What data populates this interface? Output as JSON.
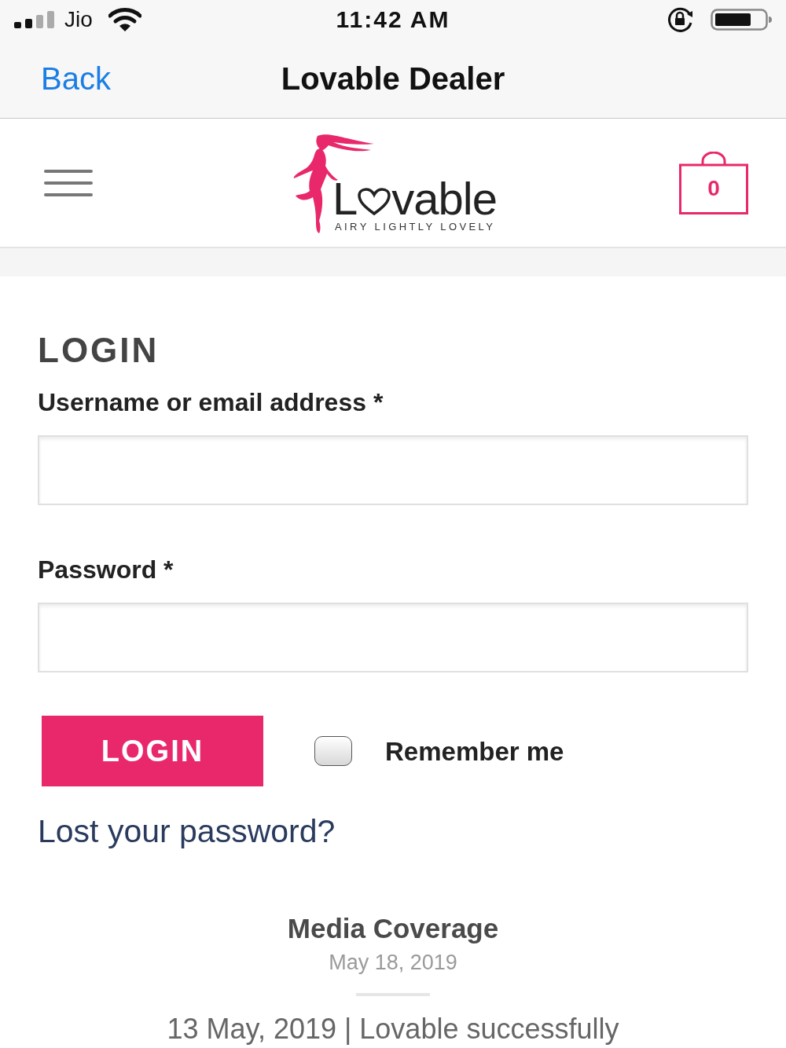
{
  "status_bar": {
    "carrier": "Jio",
    "time": "11:42 AM"
  },
  "nav_bar": {
    "back": "Back",
    "title": "Lovable Dealer"
  },
  "header": {
    "logo": {
      "wordmark_start": "L",
      "wordmark_end": "vable",
      "tagline": "AIRY LIGHTLY LOVELY"
    },
    "cart": {
      "count": "0"
    }
  },
  "login": {
    "heading": "LOGIN",
    "fields": [
      {
        "label": "Username or email address *"
      },
      {
        "label": "Password *"
      }
    ],
    "submit": "LOGIN",
    "remember_me": {
      "label": "Remember me",
      "checked": false
    },
    "lost_password": "Lost your password?"
  },
  "post": {
    "title": "Media Coverage",
    "date": "May 18, 2019",
    "excerpt": "13 May, 2019 | Lovable successfully"
  }
}
